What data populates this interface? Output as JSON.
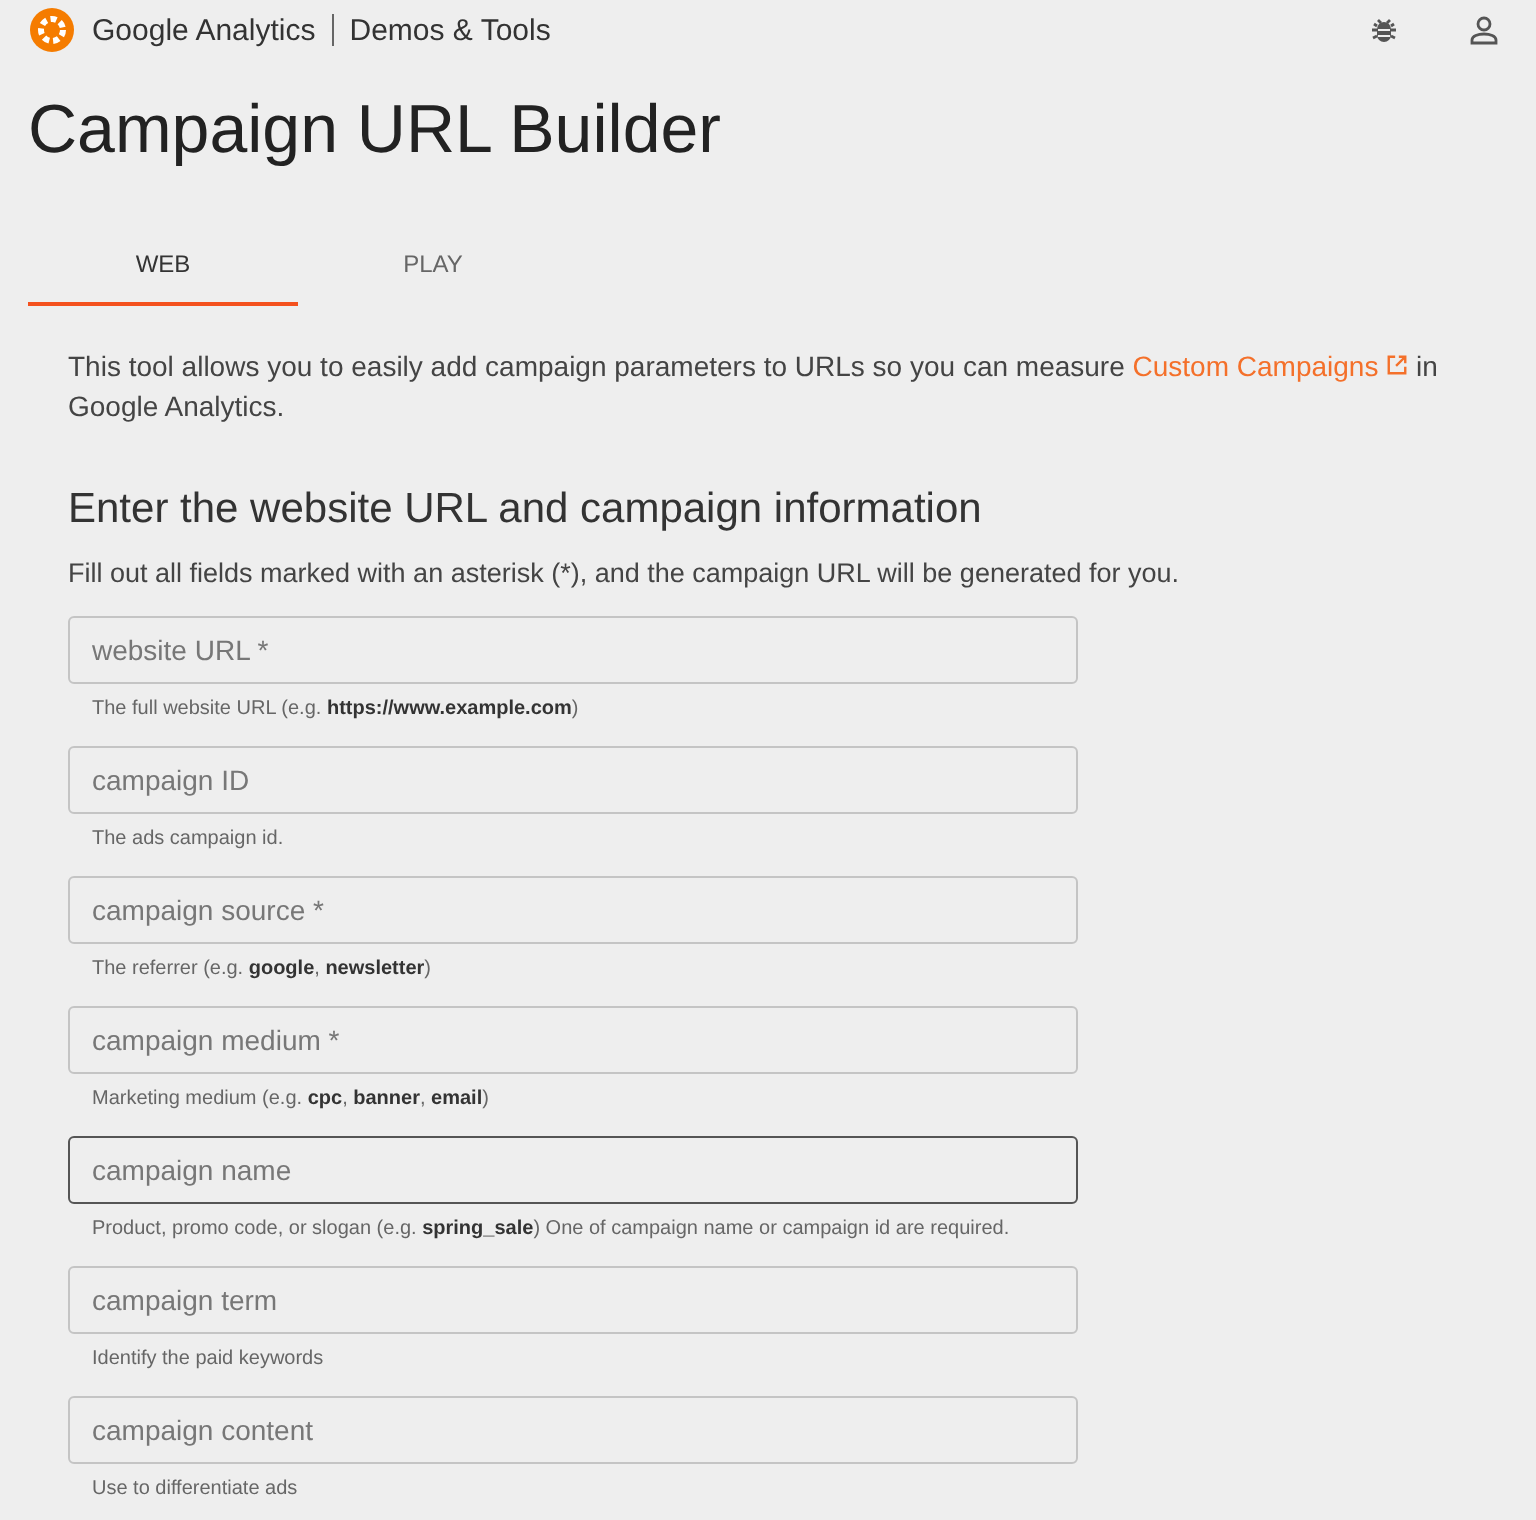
{
  "header": {
    "brand": "Google Analytics",
    "product": "Demos & Tools"
  },
  "title": "Campaign URL Builder",
  "tabs": [
    {
      "label": "WEB",
      "selected": true
    },
    {
      "label": "PLAY",
      "selected": false
    }
  ],
  "intro": {
    "before": "This tool allows you to easily add campaign parameters to URLs so you can measure",
    "link": "Custom Campaigns",
    "after": "in Google Analytics."
  },
  "section": {
    "heading": "Enter the website URL and campaign information",
    "instructions": "Fill out all fields marked with an asterisk (*), and the campaign URL will be generated for you."
  },
  "fields": [
    {
      "placeholder": "website URL *",
      "helper": "The full website URL (e.g. **https://www.example.com**)",
      "focused": false
    },
    {
      "placeholder": "campaign ID",
      "helper": "The ads campaign id.",
      "focused": false
    },
    {
      "placeholder": "campaign source *",
      "helper": "The referrer (e.g. **google**, **newsletter**)",
      "focused": false
    },
    {
      "placeholder": "campaign medium *",
      "helper": "Marketing medium (e.g. **cpc**, **banner**, **email**)",
      "focused": false
    },
    {
      "placeholder": "campaign name",
      "helper": "Product, promo code, or slogan (e.g. **spring_sale**) One of campaign name or campaign id are required.",
      "focused": true
    },
    {
      "placeholder": "campaign term",
      "helper": "Identify the paid keywords",
      "focused": false
    },
    {
      "placeholder": "campaign content",
      "helper": "Use to differentiate ads",
      "focused": false
    }
  ]
}
